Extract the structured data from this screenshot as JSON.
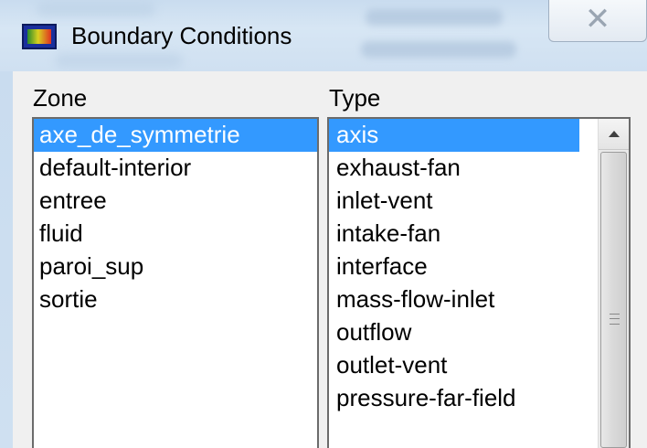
{
  "window": {
    "title": "Boundary Conditions",
    "close_glyph": "✕",
    "icon": "fluent-app-icon"
  },
  "zone": {
    "label": "Zone",
    "items": [
      {
        "label": "axe_de_symmetrie",
        "selected": true
      },
      {
        "label": "default-interior",
        "selected": false
      },
      {
        "label": "entree",
        "selected": false
      },
      {
        "label": "fluid",
        "selected": false
      },
      {
        "label": "paroi_sup",
        "selected": false
      },
      {
        "label": "sortie",
        "selected": false
      }
    ]
  },
  "type": {
    "label": "Type",
    "items": [
      {
        "label": "axis",
        "selected": true
      },
      {
        "label": "exhaust-fan",
        "selected": false
      },
      {
        "label": "inlet-vent",
        "selected": false
      },
      {
        "label": "intake-fan",
        "selected": false
      },
      {
        "label": "interface",
        "selected": false
      },
      {
        "label": "mass-flow-inlet",
        "selected": false
      },
      {
        "label": "outflow",
        "selected": false
      },
      {
        "label": "outlet-vent",
        "selected": false
      },
      {
        "label": "pressure-far-field",
        "selected": false
      }
    ]
  },
  "colors": {
    "selection": "#3399ff",
    "titlebar": "#cfe0f1",
    "dialog_bg": "#f0f0f0"
  }
}
